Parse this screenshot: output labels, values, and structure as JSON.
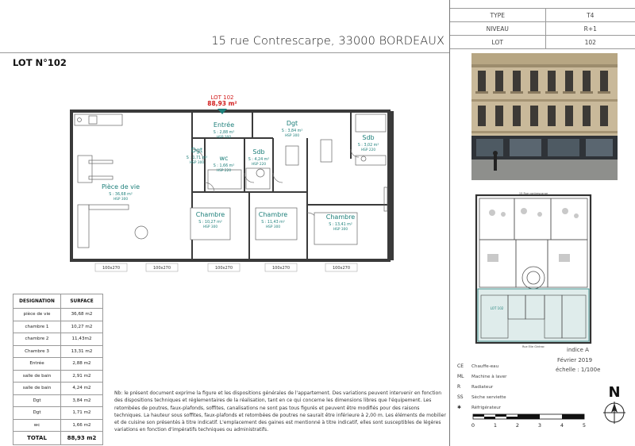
{
  "header": {
    "address": "15 rue Contrescarpe, 33000 BORDEAUX",
    "lot_title": "LOT N°102"
  },
  "info_table": [
    {
      "label": "TYPE",
      "value": "T4"
    },
    {
      "label": "NIVEAU",
      "value": "R+1"
    },
    {
      "label": "LOT",
      "value": "102"
    }
  ],
  "plan": {
    "lot_label": "LOT 102",
    "lot_surface": "88,93 m²",
    "rooms": [
      {
        "name": "Entrée",
        "area": "S : 2,88 m²",
        "hsp": "HSP 300"
      },
      {
        "name": "Dgt",
        "area": "S : 3,84 m²",
        "hsp": "HSP 300"
      },
      {
        "name": "Sdb",
        "area": "S : 3,02 m²",
        "hsp": "HSP 220"
      },
      {
        "name": "Dgt",
        "area": "S : 1,71 m²",
        "hsp": "HSP 300"
      },
      {
        "name": "wc",
        "area": "S : 1,66 m²",
        "hsp": "HSP 220"
      },
      {
        "name": "Sdb",
        "area": "S : 4,24 m²",
        "hsp": "HSP 220"
      },
      {
        "name": "Pièce de vie",
        "area": "S : 36,68 m²",
        "hsp": "HSP 300"
      },
      {
        "name": "Chambre",
        "area": "S : 10,27 m²",
        "hsp": "HSP 300"
      },
      {
        "name": "Chambre",
        "area": "S : 11,43 m²",
        "hsp": "HSP 300"
      },
      {
        "name": "Chambre",
        "area": "S : 13,41 m²",
        "hsp": "HSP 300"
      }
    ],
    "windows": [
      "100x270",
      "100x270",
      "100x270",
      "100x270",
      "100x270"
    ]
  },
  "surface_table": {
    "headers": [
      "DESIGNATION",
      "SURFACE"
    ],
    "rows": [
      [
        "pièce de vie",
        "36,68 m2"
      ],
      [
        "chambre 1",
        "10,27 m2"
      ],
      [
        "chambre 2",
        "11,43m2"
      ],
      [
        "Chambre 3",
        "13,31 m2"
      ],
      [
        "Entrée",
        "2,88 m2"
      ],
      [
        "salle de bain",
        "2,91 m2"
      ],
      [
        "salle de bain",
        "4,24 m2"
      ],
      [
        "Dgt",
        "3,84 m2"
      ],
      [
        "Dgt",
        "1,71 m2"
      ],
      [
        "wc",
        "1,66 m2"
      ]
    ],
    "total": [
      "TOTAL",
      "88,93 m2"
    ]
  },
  "disclaimer": "Nb: le présent document exprime la figure et les dispositions générales de l'appartement. Des variations peuvent intervenir en fonction des dispositions techniques et réglementaires de la réalisation, tant en ce qui concerne les dimensions libres que l'équipement. Les retombées de poutres, faux-plafonds, soffites, canalisations ne sont pas tous figurés et peuvent être modifiés pour des raisons techniques. La hauteur sous soffites, faux-plafonds et retombées de poutres ne saurait être inférieure à 2,00 m. Les éléments de mobilier et de cuisine son présentés à titre indicatif. L'emplacement des gaines est mentionné à titre indicatif, elles sont susceptibles de légères variations en fonction d'impératifs techniques ou administratifs.",
  "legend": [
    {
      "symbol": "CE",
      "label": "Chauffe-eau"
    },
    {
      "symbol": "ML",
      "label": "Machine à laver"
    },
    {
      "symbol": "R",
      "label": "Radiateur"
    },
    {
      "symbol": "SS",
      "label": "Sèche serviette"
    },
    {
      "symbol": "✱",
      "label": "Réfrigérateur"
    }
  ],
  "meta": {
    "indice": "indice A",
    "date": "Février 2019",
    "echelle": "échelle : 1/100e"
  },
  "north": "N",
  "scale_ticks": [
    "0",
    "1",
    "2",
    "3",
    "4",
    "5"
  ],
  "location_plan": {
    "street_top": "15 Rue contrescarpe",
    "street_bottom": "Rue Elie Gintrac",
    "lot_label": "LOT 102"
  },
  "colors": {
    "lot_red": "#d21e1e",
    "room_teal": "#1d7f7a",
    "wall": "#3a3a3a"
  }
}
